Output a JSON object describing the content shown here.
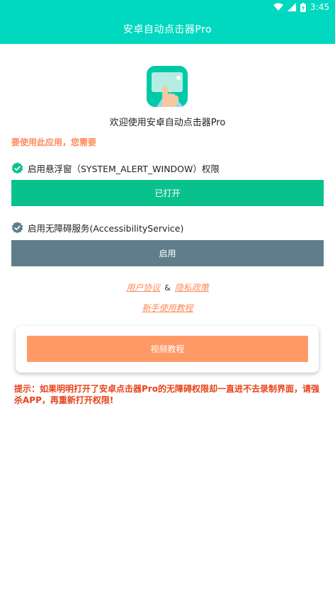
{
  "status_bar": {
    "time": "3:45",
    "icons": [
      "wifi-icon",
      "signal-icon",
      "battery-icon"
    ]
  },
  "app_bar": {
    "title": "安卓自动点击器Pro"
  },
  "header": {
    "welcome": "欢迎使用安卓自动点击器Pro"
  },
  "need_text": "要使用此应用，您需要",
  "permissions": [
    {
      "label": "启用悬浮窗（SYSTEM_ALERT_WINDOW）权限",
      "icon": "check-badge-icon",
      "icon_color": "#09c18c",
      "button_label": "已打开",
      "button_color": "#09c18c"
    },
    {
      "label": "启用无障碍服务(AccessibilityService)",
      "icon": "check-badge-icon",
      "icon_color": "#607d8b",
      "button_label": "启用",
      "button_color": "#607d8b"
    }
  ],
  "links": {
    "user_agreement": "用户协议",
    "separator": "&",
    "privacy_policy": "隐私政策",
    "tutorial": "新手使用教程"
  },
  "video_card": {
    "button_label": "视频教程",
    "button_color": "#ff9a66"
  },
  "tip": "提示：如果明明打开了安卓点击器Pro的无障碍权限却一直进不去录制界面，请强杀APP，再重新打开权限!",
  "colors": {
    "accent": "#00d9c0",
    "link": "#ff8a5b",
    "warning": "#e8421a"
  }
}
